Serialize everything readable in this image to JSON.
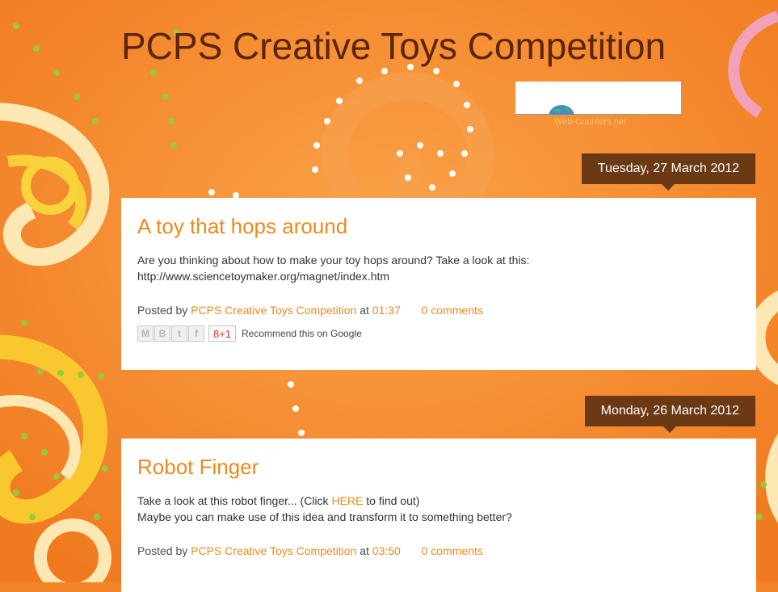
{
  "blog": {
    "title": "PCPS Creative Toys Competition",
    "counter_label": "Web-Counters.net"
  },
  "colors": {
    "background": "#f3862a",
    "title": "#5b2508",
    "accent": "#ec8a1c",
    "date_badge": "#6b3a14",
    "post_bg": "#ffffff"
  },
  "posts": [
    {
      "date": "Tuesday, 27 March 2012",
      "title": "A toy that hops around",
      "body_line1": "Are you thinking about how to make your toy hops around? Take a look at this:",
      "body_line2": "http://www.sciencetoymaker.org/magnet/index.htm",
      "posted_by_label": "Posted by",
      "author": "PCPS Creative Toys Competition",
      "at_label": "at",
      "time": "01:37",
      "comments": "0 comments",
      "share_icons": [
        "gmail-icon",
        "blogger-icon",
        "twitter-icon",
        "facebook-icon"
      ],
      "gplus_label": "8+1",
      "recommend_text": "Recommend this on Google"
    },
    {
      "date": "Monday, 26 March 2012",
      "title": "Robot Finger",
      "body_prefix": "Take a look at this robot finger... (Click ",
      "body_link": "HERE",
      "body_suffix": " to find out)",
      "body_line2": "Maybe you can make use of this idea and transform it to something better?",
      "posted_by_label": "Posted by",
      "author": "PCPS Creative Toys Competition",
      "at_label": "at",
      "time": "03:50",
      "comments": "0 comments"
    }
  ]
}
